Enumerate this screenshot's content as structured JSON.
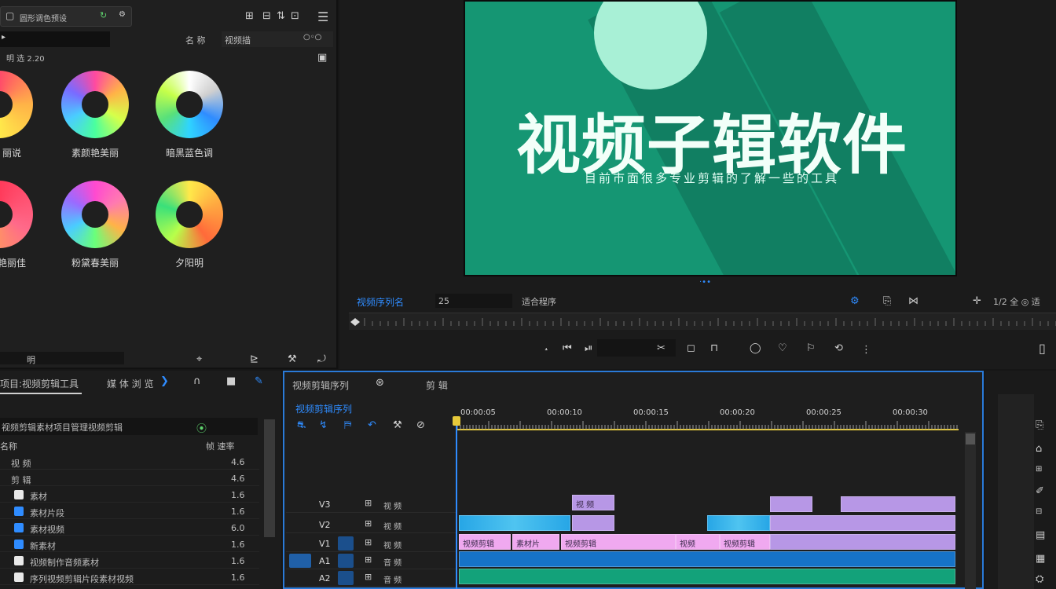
{
  "left_panel": {
    "preset_title": "圆形调色预设",
    "search_placeholder": "",
    "tab_a": "名 称",
    "tab_b": "视频描",
    "toolbar_row": "明 选 2.20",
    "wheels": [
      {
        "label": "丽说"
      },
      {
        "label": "素颜艳美丽"
      },
      {
        "label": "暗黑蓝色调"
      },
      {
        "label": "艳丽佳"
      },
      {
        "label": "粉黛春美丽"
      },
      {
        "label": "夕阳明"
      }
    ],
    "bottom_value": "明"
  },
  "monitor": {
    "title": "视频子辑软件",
    "subtitle": "目前市面很多专业剪辑的了解一些的工具",
    "dots": "·••",
    "sequence_name": "视频序列名",
    "timecode_box": "25",
    "fit_label": "适合程序",
    "right_label": "1/2 全 ◎ 适"
  },
  "project_panel": {
    "title": "项目:视频剪辑工具",
    "tab_a": "媒 体 浏 览",
    "bin_label": "视频剪辑素材项目管理视频剪辑",
    "header_name": "名称",
    "header_rate": "帧 速率",
    "rows": [
      {
        "name": "视 频",
        "value": "4.6"
      },
      {
        "name": "剪 辑",
        "value": "4.6"
      },
      {
        "name": "素材",
        "value": "1.6"
      },
      {
        "name": "素材片段",
        "value": "1.6"
      },
      {
        "name": "素材视频",
        "value": "6.0"
      },
      {
        "name": "新素材",
        "value": "1.6"
      },
      {
        "name": "视频制作音频素材",
        "value": "1.6"
      },
      {
        "name": "序列视频剪辑片段素材视频",
        "value": "1.6"
      }
    ]
  },
  "timeline": {
    "tab": "视频剪辑序列",
    "tab2": "剪 辑",
    "sequence_timecode": "视频剪辑序列",
    "time_labels": [
      "00:00:05",
      "00:00:10",
      "00:00:15",
      "00:00:20",
      "00:00:25",
      "00:00:30"
    ],
    "tracks": [
      {
        "name": "V3",
        "label": "视 频"
      },
      {
        "name": "V2",
        "label": "视 频"
      },
      {
        "name": "V1",
        "label": "视 频"
      },
      {
        "name": "A1",
        "label": "音 频"
      },
      {
        "name": "A2",
        "label": "音 频"
      }
    ],
    "clip_labels": [
      "视 频",
      "视频剪辑",
      "素材片",
      "视频剪辑",
      "视频",
      "视频剪辑"
    ]
  },
  "colors": {
    "accent": "#2f8cff",
    "screen_bg": "#159673",
    "moon": "#a8f0d6",
    "playhead_bar": "#e6c93a"
  }
}
